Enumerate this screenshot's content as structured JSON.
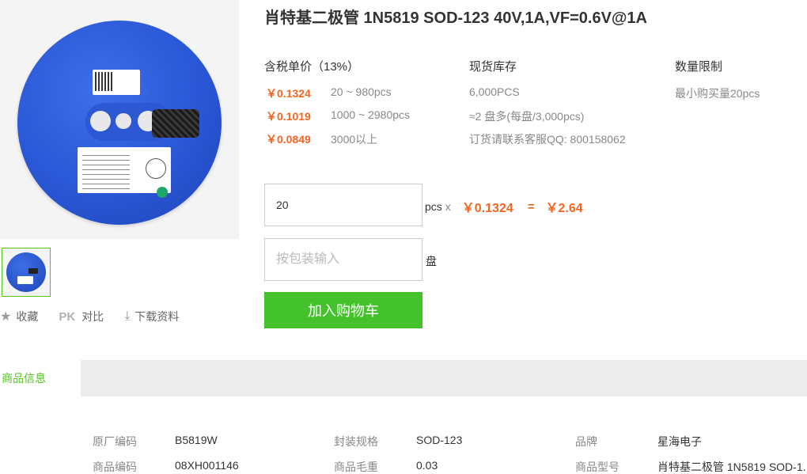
{
  "product": {
    "title": "肖特基二极管 1N5819 SOD-123 40V,1A,VF=0.6V@1A"
  },
  "price_column": {
    "heading": "含税单价（13%）",
    "tiers": [
      {
        "price": "￥0.1324",
        "range": "20 ~ 980pcs"
      },
      {
        "price": "￥0.1019",
        "range": "1000 ~ 2980pcs"
      },
      {
        "price": "￥0.0849",
        "range": "3000以上"
      }
    ]
  },
  "stock_column": {
    "heading": "现货库存",
    "lines": [
      "6,000PCS",
      "≈2 盘多(每盘/3,000pcs)",
      "订货请联系客服QQ: 800158062"
    ]
  },
  "limit_column": {
    "heading": "数量限制",
    "text": "最小购买量20pcs"
  },
  "order": {
    "quantity_value": "20",
    "unit_label": "pcs",
    "times": "x",
    "unit_price": "￥0.1324",
    "equals": "=",
    "total": "￥2.64",
    "reel_placeholder": "按包装输入",
    "reel_unit": "盘",
    "add_to_cart": "加入购物车"
  },
  "actions": {
    "favorite": "收藏",
    "compare_badge": "PK",
    "compare": "对比",
    "download": "下载资料"
  },
  "tabs": {
    "active": "商品信息"
  },
  "specs": [
    {
      "k": "原厂编码",
      "v": "B5819W"
    },
    {
      "k": "封装规格",
      "v": "SOD-123"
    },
    {
      "k": "品牌",
      "v": "星海电子"
    },
    {
      "k": "商品编码",
      "v": "08XH001146"
    },
    {
      "k": "商品毛重",
      "v": "0.03"
    },
    {
      "k": "商品型号",
      "v": "肖特基二极管 1N5819 SOD-1."
    }
  ],
  "icons": {
    "favorite": "star-icon",
    "download": "download-icon"
  },
  "colors": {
    "accent_green": "#43c22b",
    "price_orange": "#f26522"
  }
}
